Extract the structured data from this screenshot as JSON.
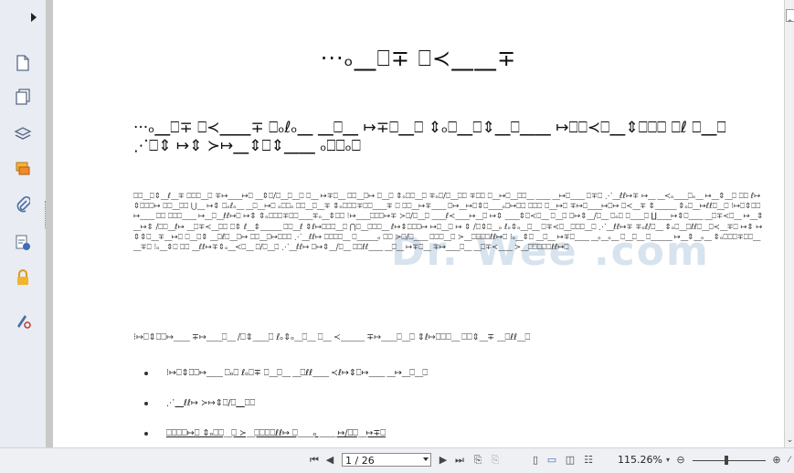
{
  "sidebar": {
    "items": [
      {
        "name": "expand-arrow",
        "icon": "triangle-right-icon"
      },
      {
        "name": "page-thumbnail",
        "icon": "page-icon"
      },
      {
        "name": "pages-panel",
        "icon": "pages-icon"
      },
      {
        "name": "layers-panel",
        "icon": "layers-icon"
      },
      {
        "name": "comments-panel",
        "icon": "comment-icon"
      },
      {
        "name": "attachments-panel",
        "icon": "paperclip-icon"
      },
      {
        "name": "signatures-panel",
        "icon": "signature-icon"
      },
      {
        "name": "security-panel",
        "icon": "lock-icon"
      },
      {
        "name": "tools-panel",
        "icon": "pen-tool-icon"
      }
    ]
  },
  "document": {
    "title": "···ₒ⎽⎕∓ ⎕≺⎽⎽∓",
    "subtitle": "···ₒ⎽⎕∓ ⎕≺⎽⎽∓ ⎕ₒℓₒ⎽ ⎽⎕⎽ ↦∓⎕⎽⎕ ⇕ₒ⎕⎽⎕⇕⎽⎕⎽⎽ ↦⎕⎕≺⎕⎽⇕⎕⎕⎕ ⎕ℓ ⎕⎽⎕ ⋰⎕⇕ ↦⇕ ≻↦⎽⇕⎕⇕⎽⎽ ₒ⎕⎕ₒ⎕",
    "paragraph1": "⎕⎕⎽⎕⇕⎽ℓ⎽∓ ⎕⎕⎕⎽⎕ ∓↦⎽⎽↦⎕ ⎽⇕⎕/⎕⎽⎕⎽⎕ ⎕⎽ ↦∓⎕⎽ ⎕⎕⎽⎕↦ ⎕⎽⎕ ⇕ₒ⎕⎕⎽⎕ ∓ₒ⎕/⎕⎽⎕⎕ ∓⎕⎕ ⎕⎽↦⎕⎽⎕⎕⎽ ⎽⎽ ⎽↦⎕⎽⎽ ⎕∓⎕ ⋰⎽ℓℓ↦∓ ↦⎽ ⎽≺ₒ⎽⎽⎕ₒ⎽ ↦⎽⇕⎽⎕ ⎕⎕ ℓ↦⇕⎕⎕⎕↦ ⎕⎕⎽⎕⎕ ⋃⎽ ↦⇕ ⎕ₒℓₒ⎽ ⎽⎕⎽↦⎕ ₒ⎕⎕ₒ ⎕⎕⎽⎕⎽∓ ⇕ₒ⎕⎕⎕∓⎕⎕⎽⎽∓ ⎕ ⎕⎕⎽↦∓⎽⎽ ⎕↦⎽↦⎕⇕⎕⎽⎽ₒ⎕↦⎕⎕ ⎕⎕⎕ ⎕⎽↦⎕ ∓↦⎕⎽⎽↦⎕↦ ⎕≺⎽∓ ⇕⎽⎽⎽ ⇕ₒ⎕⎽↦ℓℓ⎕⎽⎕ ⁝↦⎕⇕⎕⎕↦⎽⎽ ⎕⎕ ⎕⎕⎕⎽⎽ ↦⎽⎕⎽ℓℓ↦⎕ ↦⇕ ⇕ₒ⎕⎕⎕∓⎕⎕⎽⎽∓ₒ⎽⇕⎕⎕ ⁝↦⎽⎽⎕⎕⎕↦∓ ≻⎕/⎕⎽⎕ ⎽⎽ℓ≺⎽⎽↦⎽⎕ ↦⇕ ⎽⎽⇕⎕≺⎕⎽ ⎕⎽⎕ ⎕↦⇕⎽/⎕⎽ ⎕ₒ⎕ ⎕⎽⎽⎕ ∐⎽⎽↦⇕⎕⎽⎽ ⎽⎕∓≺⎕⎽ ↦⎽⇕⎽↦⇕ /⎕⎕⎽ℓ↦ ⎽⎕∓≺⎽⎕⎕ ⎕⇕ ℓ⎽⇕⎽⎽⎽ ⎕⎕⎽ℓ ⇕ℓ↦⎕⎕⎕⎽⎕ ⋂⎕⎽⎕⎕⎕⎽ ℓ↦⇕⎕⎕⎕↦ ↦⎕⎽⎕ ↦ ⇕ /⎕⇕⎕⎽ₒ ℓₒ⇕ₒ⎽⎕⎽ ⎕∓≺⎕⎽⎕⎕⎕⎽⎕ ⋰⎽ℓℓ↦∓ ∓ₒℓ/⎕⎽ ⇕ₒ⎕⎽⎕ℓℓ⎕⎽⎕≺⎽∓⎕ ↦⇕ ↦⇕⇕⎕⎽∓⎽↦⎕ ⎕⎽⎕⇕ ⎽⎕ℓ⎕⎽⎕↦ ⎕⎕⎽⎕↦⎕⎕⎕ ⋰⎽ℓℓ↦ ⎕⎕⎕⎕⎽ ⎕⎽⎽⎽ₒ ⎕⎕ ≻⎕/⎕⎽⎽ ⎕⎕⎕⎽⎕ ≻⎽⎕⎕⎕⎕ℓℓ↦⎕ ⁝ₒ⎽⇕⎕ ⎽⎕⎽ ↦∓⎕⎽⎽ ⎽ₒ⎽ₒ⎽ ⎕⎽⎕⎽ ⎕⎽⎽⎽ ↦⎽⇕⎽ₒ⎽ ⇕ₒ⎕⎕⎕∓⎕⎕⎽⎽∓⎕ ⁝ₒ⎽⇕⎕ ⎕⎕ ⎽ℓℓ↦∓⇕ₒ⎽≺⎕⎽ ⎕/⎕⎽⎕ ⋰⎽ℓℓ↦ ⎕↦⇕⎽/⎕⎽ ⎕⎕ℓℓ⎽⎽ ⎽⎕⎽ ↦∓⎕⎽ ∓↦⎽⎽⎕⎽ ⎽⎕∓≺⎽⎽ ≻⎽⎕⎕⎕⎕⎕ℓℓ↦⎕",
    "paragraph2": "⁝↦⎕⇕⎕⎕↦⎽⎽ ∓↦⎽⎽⎕⎽ /⎕⇕⎽⎽⎕ ℓₒ⇕ₒ⎽⎕⎽ ⎕⎽ ≺⎽⎽⎽ ∓↦⎽⎽⎕⎽⎕ ⇕ℓ↦⎕⎕⎕⎽ ⎕⎕⇕⎽∓ ⎽⎕ℓℓ⎽⎕",
    "bullets": [
      "⁝↦⎕⇕⎕⎕↦⎽⎽ ⎕ₒ⎕ ℓₒ⎕∓ ⎕⎽⎕⎽ ⎽⎕ℓℓ⎽⎽ ≺ℓ↦⇕⎕↦⎽⎽ ⎽↦⎽⎕⎽⎕",
      "⋰⎽ℓℓ↦ ≻↦⇕⎕/⎕⎽⎕⎕",
      "⎕⎕⎕⎕↦⎕ ⇕ₒ⎕⎕⎽⎕ ≻⎽⎕⎕⎕⎕ℓℓ↦ ⎕⎽⎽ₒ ⎽⎽ ↦/⎕⎕⎽↦∓⎕"
    ],
    "watermark": "Dr. Wee .com"
  },
  "navigation": {
    "page_display": "1 / 26",
    "zoom": "115.26%"
  },
  "colors": {
    "sidebar_bg": "#e9ecf2",
    "doc_bg": "#c9c9c9",
    "toolbar_bg": "#eef0f4",
    "active_view_icon": "#3b6fb6"
  }
}
